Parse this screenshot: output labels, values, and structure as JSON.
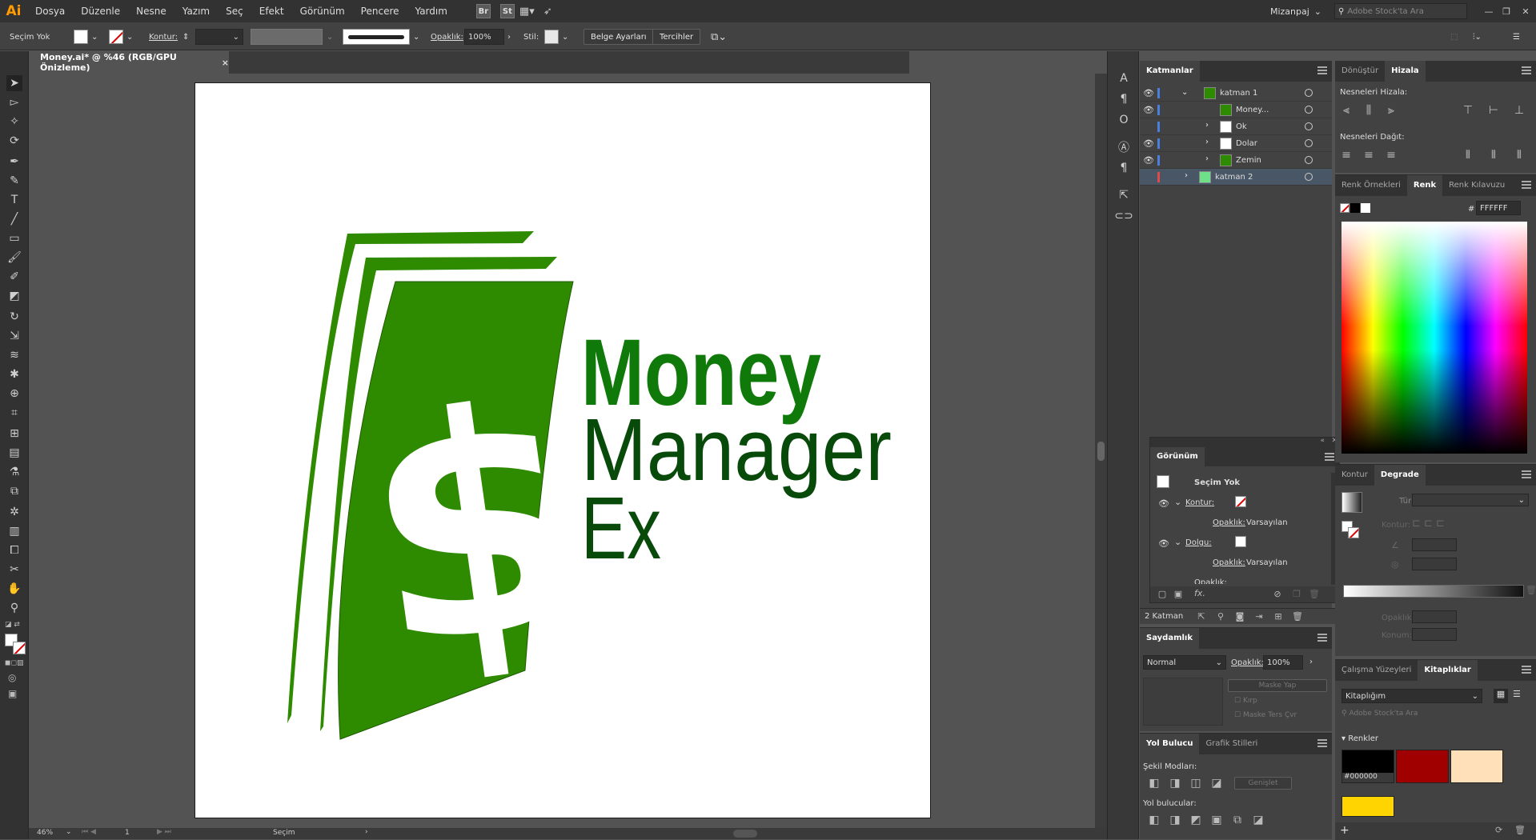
{
  "app": {
    "logo": "Ai"
  },
  "menu": [
    "Dosya",
    "Düzenle",
    "Nesne",
    "Yazım",
    "Seç",
    "Efekt",
    "Görünüm",
    "Pencere",
    "Yardım"
  ],
  "menubar_right": {
    "bridge": "Br",
    "stock": "St",
    "workspace": "Mizanpaj",
    "search_placeholder": "Adobe Stock'ta Ara"
  },
  "control": {
    "selection": "Seçim Yok",
    "stroke_label": "Kontur:",
    "opacity_label": "Opaklık:",
    "opacity_value": "100%",
    "style_label": "Stil:",
    "document_setup": "Belge Ayarları",
    "preferences": "Tercihler"
  },
  "document_tab": {
    "title": "Money.ai* @ %46 (RGB/GPU Önizleme)",
    "close": "×"
  },
  "artwork": {
    "dollar": "$",
    "line1": "Money",
    "line2": "Manager",
    "line3": "Ex",
    "colors": {
      "green_light": "#2e8b00",
      "green_dark": "#0b5a07",
      "green_mid": "#0f7a09",
      "text_dark": "#084a0a"
    }
  },
  "status": {
    "zoom": "46%",
    "page": "1",
    "tool": "Seçim"
  },
  "layers_panel": {
    "title": "Katmanlar",
    "rows": [
      {
        "name": "katman 1",
        "color": "#4a7fe0"
      },
      {
        "name": "Money...",
        "color": "#4a7fe0"
      },
      {
        "name": "Ok",
        "color": "#4a7fe0"
      },
      {
        "name": "Dolar",
        "color": "#4a7fe0"
      },
      {
        "name": "Zemin",
        "color": "#4a7fe0"
      },
      {
        "name": "katman 2",
        "color": "#e04a4a"
      }
    ],
    "count": "2 Katman"
  },
  "appearance_panel": {
    "title": "Görünüm",
    "selection": "Seçim Yok",
    "stroke_label": "Kontur:",
    "opacity_label": "Opaklık:",
    "opacity_value": "Varsayılan",
    "fill_label": "Dolgu:",
    "fx": "fx."
  },
  "transparency_panel": {
    "title": "Saydamlık",
    "blend": "Normal",
    "opacity_label": "Opaklık:",
    "opacity_value": "100%",
    "make_mask": "Maske Yap",
    "clip": "Kırp",
    "invert": "Maske Ters Çvr"
  },
  "pathfinder_panel": {
    "tab1": "Yol Bulucu",
    "tab2": "Grafik Stilleri",
    "shape_modes": "Şekil Modları:",
    "expand": "Genişlet",
    "pathfinders": "Yol bulucular:"
  },
  "align_panel": {
    "tab1": "Dönüştür",
    "tab2": "Hizala",
    "align_objects": "Nesneleri Hizala:",
    "distribute": "Nesneleri Dağıt:"
  },
  "color_panel": {
    "tab1": "Renk Örnekleri",
    "tab2": "Renk",
    "tab3": "Renk Kılavuzu",
    "hex_label": "#",
    "hex": "FFFFFF"
  },
  "gradient_panel": {
    "tab1": "Kontur",
    "tab2": "Degrade",
    "type_label": "Tür:",
    "stroke_label": "Kontur:",
    "opacity_label": "Opaklık:",
    "location_label": "Konum:"
  },
  "libraries_panel": {
    "tab1": "Çalışma Yüzeyleri",
    "tab2": "Kitaplıklar",
    "library": "Kitaplığım",
    "search_placeholder": "Adobe Stock'ta Ara",
    "colors_heading": "Renkler",
    "swatches": [
      {
        "hex": "#000000",
        "label": "#000000"
      },
      {
        "hex": "#a00000",
        "label": ""
      },
      {
        "hex": "#ffe0b8",
        "label": ""
      },
      {
        "hex": "#ffd400",
        "label": ""
      }
    ]
  }
}
